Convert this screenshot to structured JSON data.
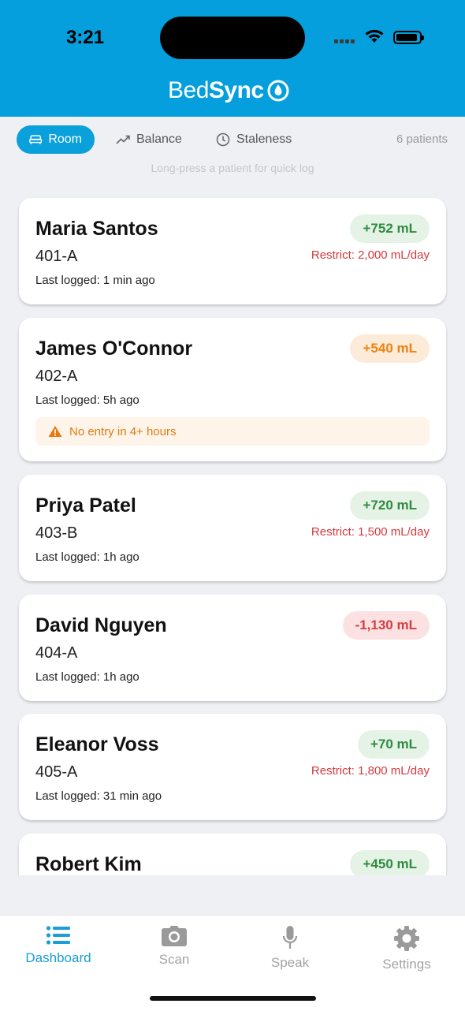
{
  "status_bar": {
    "time": "3:21"
  },
  "app": {
    "logo_light": "Bed",
    "logo_bold": "Sync"
  },
  "filters": {
    "items": [
      {
        "label": "Room",
        "icon": "bed-icon",
        "active": true
      },
      {
        "label": "Balance",
        "icon": "trend-up-icon",
        "active": false
      },
      {
        "label": "Staleness",
        "icon": "clock-icon",
        "active": false
      }
    ],
    "count": "6 patients",
    "hint": "Long-press a patient for quick log"
  },
  "patients": [
    {
      "name": "Maria Santos",
      "room": "401-A",
      "last_logged": "Last logged: 1 min ago",
      "balance": "+752 mL",
      "balance_status": "green",
      "restriction": "Restrict: 2,000 mL/day"
    },
    {
      "name": "James O'Connor",
      "room": "402-A",
      "last_logged": "Last logged: 5h ago",
      "balance": "+540 mL",
      "balance_status": "orange",
      "warning": "No entry in 4+ hours"
    },
    {
      "name": "Priya Patel",
      "room": "403-B",
      "last_logged": "Last logged: 1h ago",
      "balance": "+720 mL",
      "balance_status": "green",
      "restriction": "Restrict: 1,500 mL/day"
    },
    {
      "name": "David Nguyen",
      "room": "404-A",
      "last_logged": "Last logged: 1h ago",
      "balance": "-1,130 mL",
      "balance_status": "red"
    },
    {
      "name": "Eleanor Voss",
      "room": "405-A",
      "last_logged": "Last logged: 31 min ago",
      "balance": "+70 mL",
      "balance_status": "green",
      "restriction": "Restrict: 1,800 mL/day"
    },
    {
      "name": "Robert Kim",
      "balance": "+450 mL",
      "balance_status": "green"
    }
  ],
  "tabs": [
    {
      "label": "Dashboard",
      "icon": "list-icon",
      "active": true
    },
    {
      "label": "Scan",
      "icon": "camera-icon",
      "active": false
    },
    {
      "label": "Speak",
      "icon": "microphone-icon",
      "active": false
    },
    {
      "label": "Settings",
      "icon": "gear-icon",
      "active": false
    }
  ],
  "colors": {
    "brand": "#049fdc",
    "accent": "#0aa0db",
    "positive": "#2e8b3f",
    "warning": "#ed8211",
    "negative": "#d43d43"
  }
}
